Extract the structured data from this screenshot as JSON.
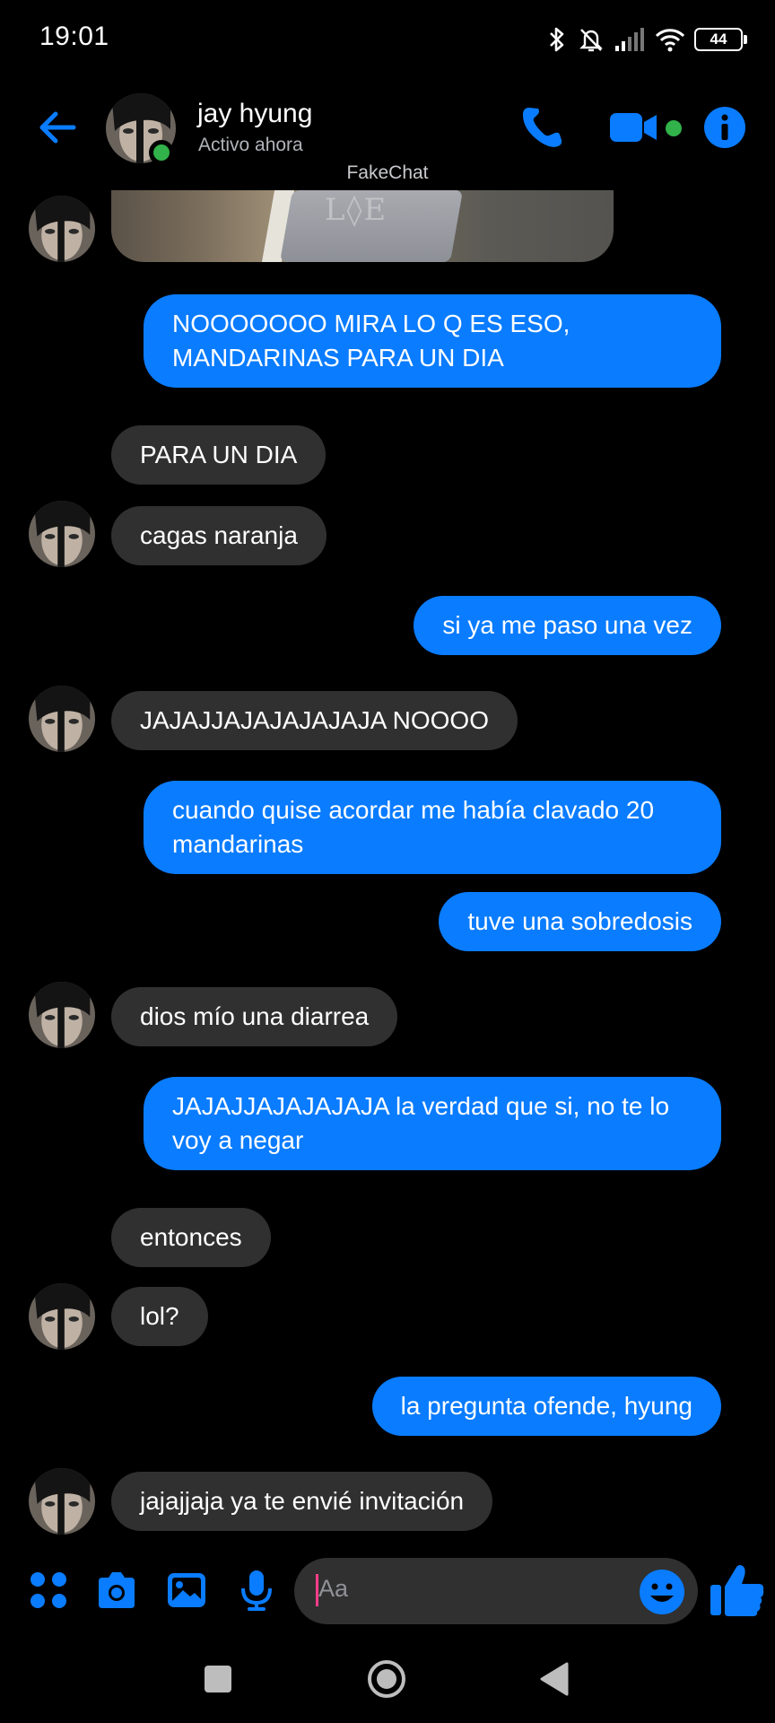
{
  "status_bar": {
    "time": "19:01",
    "battery": "44"
  },
  "header": {
    "contact_name": "jay hyung",
    "contact_status": "Activo ahora",
    "watermark": "FakeChat"
  },
  "messages": [
    {
      "side": "received",
      "text": "PARA UN DIA"
    },
    {
      "side": "received",
      "text": "cagas naranja"
    },
    {
      "side": "sent",
      "text": "NOOOOOOO MIRA LO Q ES ESO, MANDARINAS PARA UN DIA"
    },
    {
      "side": "sent",
      "text": "si ya me paso una vez"
    },
    {
      "side": "received",
      "text": "JAJAJJAJAJAJAJAJA NOOOO"
    },
    {
      "side": "sent",
      "text": "cuando quise acordar me había clavado 20 mandarinas"
    },
    {
      "side": "sent",
      "text": "tuve una sobredosis"
    },
    {
      "side": "received",
      "text": "dios mío una diarrea"
    },
    {
      "side": "sent",
      "text": "JAJAJJAJAJAJAJA la verdad que si, no te lo voy a negar"
    },
    {
      "side": "received",
      "text": "entonces"
    },
    {
      "side": "received",
      "text": "lol?"
    },
    {
      "side": "sent",
      "text": "la pregunta ofende, hyung"
    },
    {
      "side": "received",
      "text": "jajajjaja ya te envié invitación"
    }
  ],
  "composer": {
    "placeholder": "Aa"
  },
  "colors": {
    "accent": "#0a7cff",
    "received_bubble": "#303030",
    "online": "#31b24a",
    "background": "#000000"
  },
  "icons": {
    "header": [
      "back-arrow-icon",
      "phone-icon",
      "video-camera-icon",
      "info-icon"
    ],
    "composer": [
      "apps-icon",
      "camera-icon",
      "gallery-icon",
      "microphone-icon",
      "emoji-icon",
      "thumbs-up-icon"
    ],
    "nav": [
      "recents-icon",
      "home-icon",
      "back-icon"
    ]
  }
}
